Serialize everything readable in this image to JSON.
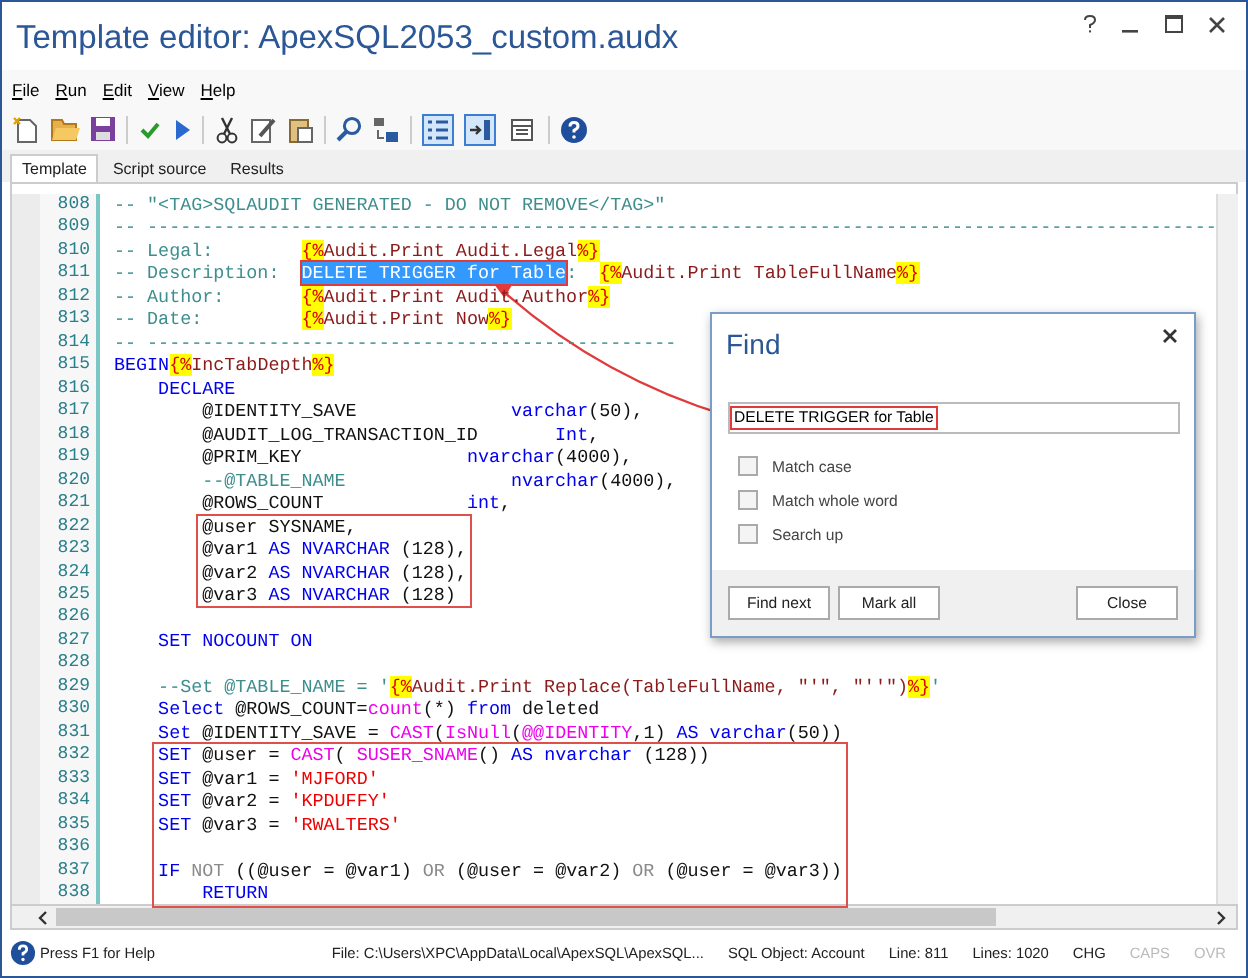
{
  "window": {
    "title": "Template editor: ApexSQL2053_custom.audx"
  },
  "menu": [
    "File",
    "Run",
    "Edit",
    "View",
    "Help"
  ],
  "toolbar": {
    "toggles": [
      {
        "pressed": true
      },
      {
        "pressed": true
      },
      {
        "pressed": false
      }
    ]
  },
  "tabs": [
    {
      "label": "Template",
      "selected": true
    },
    {
      "label": "Script source",
      "selected": false
    },
    {
      "label": "Results",
      "selected": false
    }
  ],
  "editor": {
    "blocks": [
      {
        "boxed": false,
        "lines": [
          {
            "number": "808",
            "tokens": [
              {
                "kind": "comment",
                "text": "-- \"<TAG>SQLAUDIT GENERATED - DO NOT REMOVE</TAG>\""
              }
            ]
          },
          {
            "number": "809",
            "tokens": [
              {
                "kind": "comment",
                "text": "-- -------------------------------------------------------------------------------------------------"
              }
            ]
          },
          {
            "number": "810",
            "tokens": [
              {
                "kind": "comment",
                "text": "-- Legal:        "
              },
              {
                "kind": "macro",
                "text": "{%"
              },
              {
                "kind": "directive",
                "text": "Audit.Print Audit.Legal"
              },
              {
                "kind": "macro",
                "text": "%}"
              }
            ]
          },
          {
            "number": "811",
            "tokens": [
              {
                "kind": "comment",
                "text": "-- Description:  "
              },
              {
                "kind": "selection",
                "text": "DELETE TRIGGER for Table"
              },
              {
                "kind": "comment",
                "text": ":  "
              },
              {
                "kind": "macro",
                "text": "{%"
              },
              {
                "kind": "directive",
                "text": "Audit.Print TableFullName"
              },
              {
                "kind": "macro",
                "text": "%}"
              }
            ]
          },
          {
            "number": "812",
            "tokens": [
              {
                "kind": "comment",
                "text": "-- Author:       "
              },
              {
                "kind": "macro",
                "text": "{%"
              },
              {
                "kind": "directive",
                "text": "Audit.Print Audit.Author"
              },
              {
                "kind": "macro",
                "text": "%}"
              }
            ]
          },
          {
            "number": "813",
            "tokens": [
              {
                "kind": "comment",
                "text": "-- Date:         "
              },
              {
                "kind": "macro",
                "text": "{%"
              },
              {
                "kind": "directive",
                "text": "Audit.Print Now"
              },
              {
                "kind": "macro",
                "text": "%}"
              }
            ]
          },
          {
            "number": "814",
            "tokens": [
              {
                "kind": "comment",
                "text": "-- ------------------------------------------------"
              }
            ]
          },
          {
            "number": "815",
            "tokens": [
              {
                "kind": "keyword",
                "text": "BEGIN"
              },
              {
                "kind": "macro",
                "text": "{%"
              },
              {
                "kind": "directive",
                "text": "IncTabDepth"
              },
              {
                "kind": "macro",
                "text": "%}"
              }
            ]
          },
          {
            "number": "816",
            "tokens": [
              {
                "kind": "keyword",
                "text": "    DECLARE"
              }
            ]
          },
          {
            "number": "817",
            "tokens": [
              {
                "kind": "plain",
                "text": "        @IDENTITY_SAVE              "
              },
              {
                "kind": "keyword",
                "text": "varchar"
              },
              {
                "kind": "plain",
                "text": "(50),"
              }
            ]
          },
          {
            "number": "818",
            "tokens": [
              {
                "kind": "plain",
                "text": "        @AUDIT_LOG_TRANSACTION_ID       "
              },
              {
                "kind": "keyword",
                "text": "Int"
              },
              {
                "kind": "plain",
                "text": ","
              }
            ]
          },
          {
            "number": "819",
            "tokens": [
              {
                "kind": "plain",
                "text": "        @PRIM_KEY               "
              },
              {
                "kind": "keyword",
                "text": "nvarchar"
              },
              {
                "kind": "plain",
                "text": "(4000),"
              }
            ]
          },
          {
            "number": "820",
            "tokens": [
              {
                "kind": "comment",
                "text": "        --@TABLE_NAME               "
              },
              {
                "kind": "keyword",
                "text": "nvarchar"
              },
              {
                "kind": "plain",
                "text": "(4000),"
              }
            ]
          },
          {
            "number": "821",
            "tokens": [
              {
                "kind": "plain",
                "text": "        @ROWS_COUNT             "
              },
              {
                "kind": "keyword",
                "text": "int"
              },
              {
                "kind": "plain",
                "text": ","
              }
            ]
          }
        ]
      },
      {
        "boxed": true,
        "lines": [
          {
            "number": "822",
            "tokens": [
              {
                "kind": "plain",
                "text": "        @user SYSNAME,"
              }
            ]
          },
          {
            "number": "823",
            "tokens": [
              {
                "kind": "plain",
                "text": "        @var1 "
              },
              {
                "kind": "keyword",
                "text": "AS NVARCHAR"
              },
              {
                "kind": "plain",
                "text": " (128),"
              }
            ]
          },
          {
            "number": "824",
            "tokens": [
              {
                "kind": "plain",
                "text": "        @var2 "
              },
              {
                "kind": "keyword",
                "text": "AS NVARCHAR"
              },
              {
                "kind": "plain",
                "text": " (128),"
              }
            ]
          },
          {
            "number": "825",
            "tokens": [
              {
                "kind": "plain",
                "text": "        @var3 "
              },
              {
                "kind": "keyword",
                "text": "AS NVARCHAR"
              },
              {
                "kind": "plain",
                "text": " (128)"
              }
            ]
          }
        ]
      },
      {
        "boxed": false,
        "lines": [
          {
            "number": "826"
          },
          {
            "number": "827",
            "tokens": [
              {
                "kind": "keyword",
                "text": "    SET NOCOUNT ON"
              }
            ]
          },
          {
            "number": "828"
          },
          {
            "number": "829",
            "tokens": [
              {
                "kind": "comment",
                "text": "    --Set @TABLE_NAME = '"
              },
              {
                "kind": "macro",
                "text": "{%"
              },
              {
                "kind": "directive",
                "text": "Audit.Print Replace(TableFullName, \"'\", \"''\")"
              },
              {
                "kind": "macro",
                "text": "%}"
              },
              {
                "kind": "comment",
                "text": "'"
              }
            ]
          },
          {
            "number": "830",
            "tokens": [
              {
                "kind": "keyword",
                "text": "    Select"
              },
              {
                "kind": "plain",
                "text": " @ROWS_COUNT="
              },
              {
                "kind": "function",
                "text": "count"
              },
              {
                "kind": "plain",
                "text": "(*) "
              },
              {
                "kind": "keyword",
                "text": "from"
              },
              {
                "kind": "plain",
                "text": " deleted"
              }
            ]
          },
          {
            "number": "831",
            "tokens": [
              {
                "kind": "keyword",
                "text": "    Set"
              },
              {
                "kind": "plain",
                "text": " @IDENTITY_SAVE = "
              },
              {
                "kind": "function",
                "text": "CAST"
              },
              {
                "kind": "plain",
                "text": "("
              },
              {
                "kind": "function",
                "text": "IsNull"
              },
              {
                "kind": "plain",
                "text": "("
              },
              {
                "kind": "function",
                "text": "@@IDENTITY"
              },
              {
                "kind": "plain",
                "text": ",1) "
              },
              {
                "kind": "keyword",
                "text": "AS varchar"
              },
              {
                "kind": "plain",
                "text": "(50))"
              }
            ]
          }
        ]
      },
      {
        "boxed": true,
        "lines": [
          {
            "number": "832",
            "tokens": [
              {
                "kind": "keyword",
                "text": "    SET"
              },
              {
                "kind": "plain",
                "text": " @user = "
              },
              {
                "kind": "function",
                "text": "CAST"
              },
              {
                "kind": "plain",
                "text": "( "
              },
              {
                "kind": "function",
                "text": "SUSER_SNAME"
              },
              {
                "kind": "plain",
                "text": "() "
              },
              {
                "kind": "keyword",
                "text": "AS nvarchar"
              },
              {
                "kind": "plain",
                "text": " (128))"
              }
            ]
          },
          {
            "number": "833",
            "tokens": [
              {
                "kind": "keyword",
                "text": "    SET"
              },
              {
                "kind": "plain",
                "text": " @var1 = "
              },
              {
                "kind": "string",
                "text": "'MJFORD'"
              }
            ]
          },
          {
            "number": "834",
            "tokens": [
              {
                "kind": "keyword",
                "text": "    SET"
              },
              {
                "kind": "plain",
                "text": " @var2 = "
              },
              {
                "kind": "string",
                "text": "'KPDUFFY'"
              }
            ]
          },
          {
            "number": "835",
            "tokens": [
              {
                "kind": "keyword",
                "text": "    SET"
              },
              {
                "kind": "plain",
                "text": " @var3 = "
              },
              {
                "kind": "string",
                "text": "'RWALTERS'"
              }
            ]
          },
          {
            "number": "836"
          },
          {
            "number": "837",
            "tokens": [
              {
                "kind": "keyword",
                "text": "    IF "
              },
              {
                "kind": "operator",
                "text": "NOT"
              },
              {
                "kind": "plain",
                "text": " ((@user = @var1) "
              },
              {
                "kind": "operator",
                "text": "OR"
              },
              {
                "kind": "plain",
                "text": " (@user = @var2) "
              },
              {
                "kind": "operator",
                "text": "OR"
              },
              {
                "kind": "plain",
                "text": " (@user = @var3))"
              }
            ]
          },
          {
            "number": "838",
            "tokens": [
              {
                "kind": "keyword",
                "text": "        RETURN"
              }
            ]
          }
        ]
      }
    ]
  },
  "find_dialog": {
    "title": "Find",
    "search_value": "DELETE TRIGGER for Table",
    "options": [
      {
        "label": "Match case",
        "checked": false
      },
      {
        "label": "Match whole word",
        "checked": false
      },
      {
        "label": "Search up",
        "checked": false
      }
    ],
    "buttons": [
      "Find next",
      "Mark all",
      "Close"
    ]
  },
  "status_bar": {
    "help": "Press F1 for Help",
    "file": "File:  C:\\Users\\XPC\\AppData\\Local\\ApexSQL\\ApexSQL...",
    "sql_object": "SQL Object: Account",
    "line": "Line: 811",
    "lines": "Lines: 1020",
    "indicators": [
      {
        "text": "CHG",
        "on": true
      },
      {
        "text": "CAPS",
        "on": false
      },
      {
        "text": "OVR",
        "on": false
      }
    ]
  }
}
